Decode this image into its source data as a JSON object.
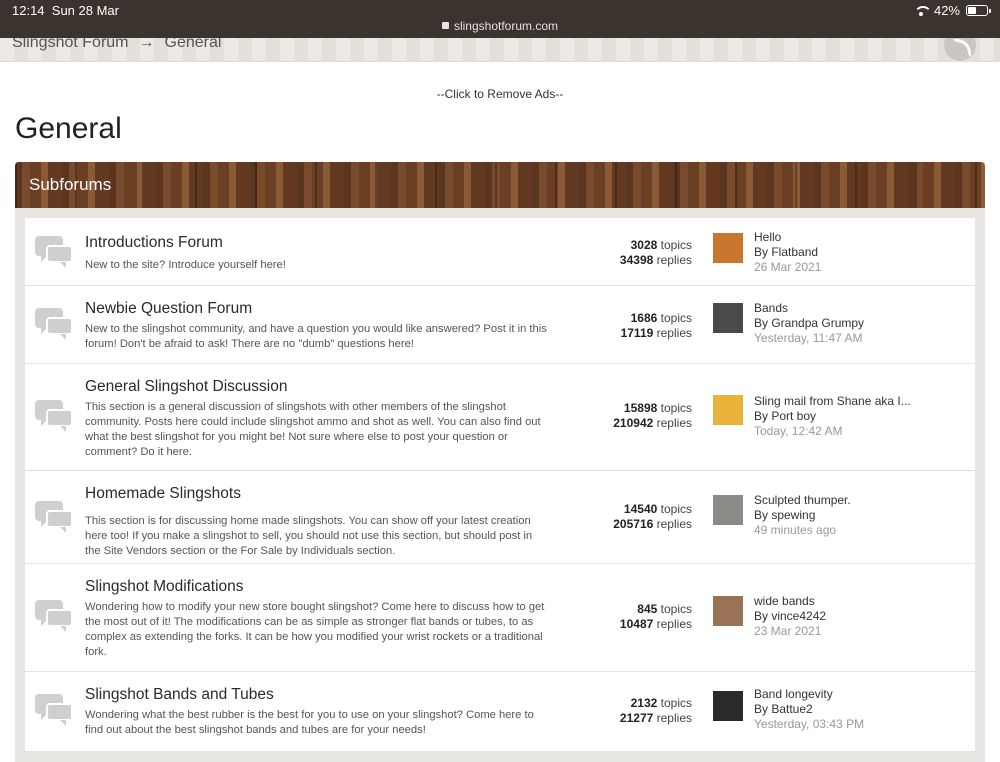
{
  "status": {
    "time": "12:14",
    "date": "Sun 28 Mar",
    "url": "slingshotforum.com",
    "battery": "42%",
    "battery_level": 0.42
  },
  "breadcrumb": {
    "root": "Slingshot Forum",
    "arrow": "→",
    "current": "General"
  },
  "ads": "--Click to Remove Ads--",
  "page_title": "General",
  "section_header": "Subforums",
  "forums": [
    {
      "name": "Introductions Forum",
      "description": "New to the site? Introduce yourself here!",
      "topics": "3028",
      "replies": "34398",
      "last_title": "Hello",
      "last_by": "By Flatband",
      "last_date": "26 Mar 2021",
      "thumb_color": "#c9772f"
    },
    {
      "name": "Newbie Question Forum",
      "description": "New to the slingshot community, and have a question you would like answered? Post it in this forum! Don't be afraid to ask! There are no \"dumb\" questions here!",
      "topics": "1686",
      "replies": "17119",
      "last_title": "Bands",
      "last_by": "By Grandpa Grumpy",
      "last_date": "Yesterday, 11:47 AM",
      "thumb_color": "#4a4a4a"
    },
    {
      "name": "General Slingshot Discussion",
      "description": "This section is a general discussion of slingshots with other members of the slingshot community. Posts here could include slingshot ammo and shot as well. You can also find out what the best slingshot for you might be! Not sure where else to post your question or comment? Do it here.",
      "topics": "15898",
      "replies": "210942",
      "last_title": "Sling mail from Shane aka I...",
      "last_by": "By Port boy",
      "last_date": "Today, 12:42 AM",
      "thumb_color": "#e9b23a"
    },
    {
      "name": "Homemade Slingshots",
      "description": "This section is for discussing home made slingshots. You can show off your latest creation here too! If you make a slingshot to sell, you should not use this section, but should post in the Site Vendors section or the For Sale by Individuals section.",
      "topics": "14540",
      "replies": "205716",
      "last_title": "Sculpted thumper.",
      "last_by": "By spewing",
      "last_date": "49 minutes ago",
      "thumb_color": "#8c8a86"
    },
    {
      "name": "Slingshot Modifications",
      "description": "Wondering how to modify your new store bought slingshot? Come here to discuss how to get the most out of it! The modifications can be as simple as stronger flat bands or tubes, to as complex as extending the forks. It can be how you modified your wrist rockets or a traditional fork.",
      "topics": "845",
      "replies": "10487",
      "last_title": "wide bands",
      "last_by": "By vince4242",
      "last_date": "23 Mar 2021",
      "thumb_color": "#9a7356"
    },
    {
      "name": "Slingshot Bands and Tubes",
      "description": "Wondering what the best rubber is the best for you to use on your slingshot? Come here to find out about the best slingshot bands and tubes are for your needs!",
      "topics": "2132",
      "replies": "21277",
      "last_title": "Band longevity",
      "last_by": "By Battue2",
      "last_date": "Yesterday, 03:43 PM",
      "thumb_color": "#2a2a2a"
    }
  ],
  "labels": {
    "topics": "topics",
    "replies": "replies"
  }
}
